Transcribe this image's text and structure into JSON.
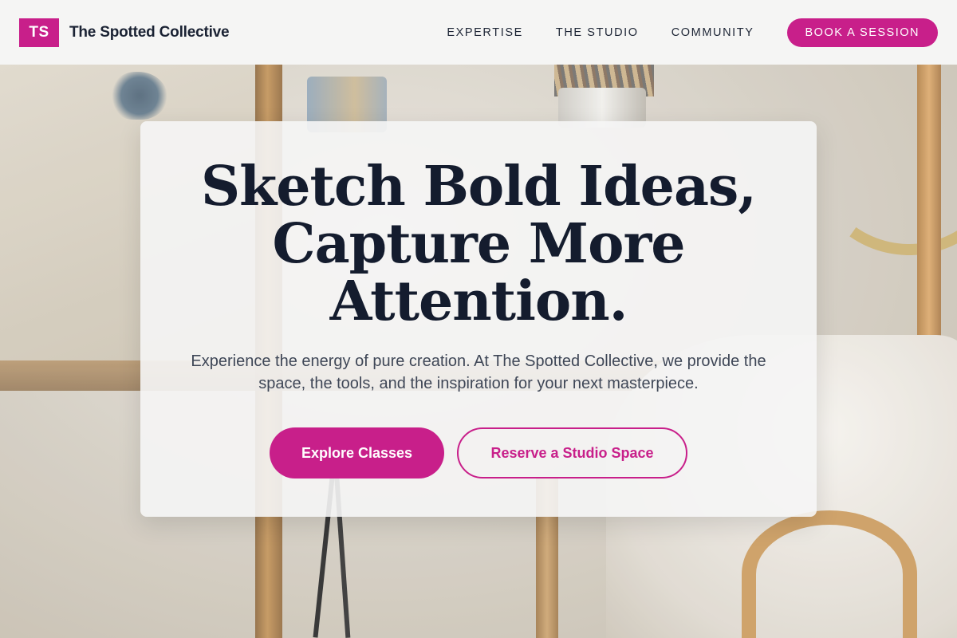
{
  "colors": {
    "accent": "#c81f8a",
    "heading": "#141c2e",
    "body_text": "#3f4757",
    "header_bg": "#f6f6f6"
  },
  "brand": {
    "logo_initials": "TS",
    "name": "The Spotted Collective"
  },
  "nav": {
    "links": [
      "EXPERTISE",
      "THE STUDIO",
      "COMMUNITY"
    ],
    "cta_label": "BOOK A SESSION"
  },
  "hero": {
    "headline_line1": "Sketch Bold Ideas,",
    "headline_line2": "Capture More",
    "headline_line3": "Attention.",
    "subtext": "Experience the energy of pure creation. At The Spotted Collective, we provide the space, the tools, and the inspiration for your next masterpiece.",
    "primary_button": "Explore Classes",
    "secondary_button": "Reserve a Studio Space"
  }
}
